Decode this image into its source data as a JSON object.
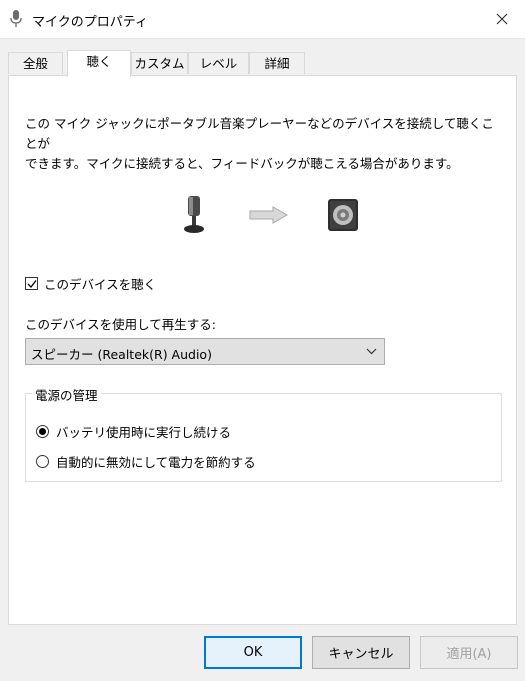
{
  "window": {
    "title": "マイクのプロパティ"
  },
  "tabs": [
    "全般",
    "聴く",
    "カスタム",
    "レベル",
    "詳細"
  ],
  "active_tab": "聴く",
  "listen": {
    "description_line1": "この マイク ジャックにポータブル音楽プレーヤーなどのデバイスを接続して聴くことが",
    "description_line2": "できます。マイクに接続すると、フィードバックが聴こえる場合があります。",
    "listen_checkbox_label": "このデバイスを聴く",
    "listen_checked": true,
    "playback_label": "このデバイスを使用して再生する:",
    "playback_device": "スピーカー (Realtek(R) Audio)"
  },
  "power": {
    "legend": "電源の管理",
    "options": [
      "バッテリ使用時に実行し続ける",
      "自動的に無効にして電力を節約する"
    ],
    "selected_index": 0
  },
  "buttons": {
    "ok": "OK",
    "cancel": "キャンセル",
    "apply": "適用(A)"
  },
  "colors": {
    "accent": "#0078d7",
    "window_bg": "#f0f0f0",
    "panel_bg": "#ffffff"
  },
  "icons": [
    "microphone-icon",
    "close-icon",
    "arrow-right-icon",
    "speaker-icon",
    "chevron-down-icon"
  ]
}
